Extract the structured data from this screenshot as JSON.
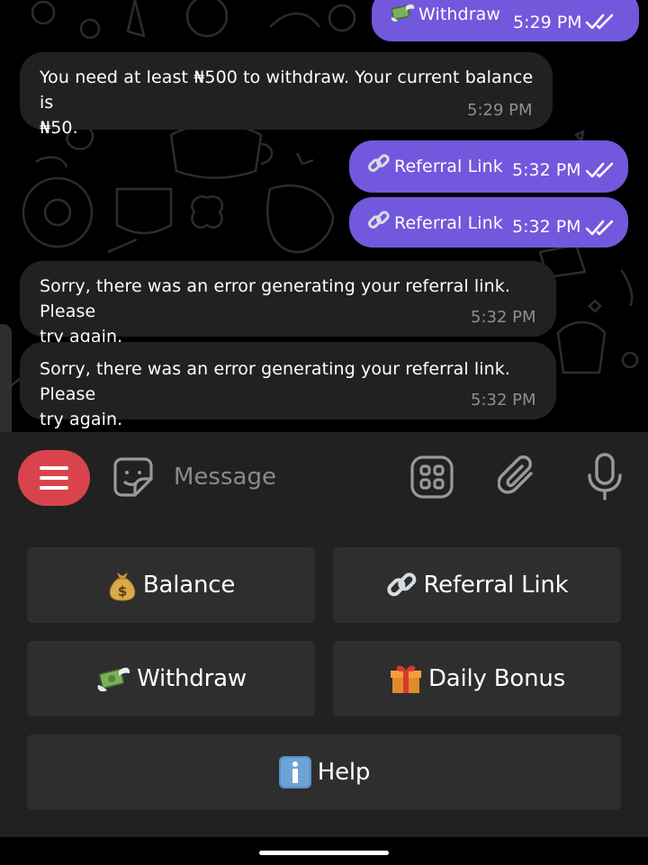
{
  "chat": {
    "messages": [
      {
        "direction": "out",
        "emoji": "money-with-wings",
        "text": "Withdraw",
        "time": "5:29 PM",
        "status": "read"
      },
      {
        "direction": "in",
        "text_line1": "You need at least ₦500 to withdraw. Your current balance is",
        "text_line2": "₦50.",
        "time": "5:29 PM"
      },
      {
        "direction": "out",
        "emoji": "link",
        "text": "Referral Link",
        "time": "5:32 PM",
        "status": "read"
      },
      {
        "direction": "out",
        "emoji": "link",
        "text": "Referral Link",
        "time": "5:32 PM",
        "status": "read"
      },
      {
        "direction": "in",
        "text_line1": "Sorry, there was an error generating your referral link. Please",
        "text_line2": "try again.",
        "time": "5:32 PM"
      },
      {
        "direction": "in",
        "text_line1": "Sorry, there was an error generating your referral link. Please",
        "text_line2": "try again.",
        "time": "5:32 PM"
      }
    ]
  },
  "composer": {
    "placeholder": "Message",
    "icons": [
      "menu-icon",
      "sticker-icon",
      "apps-icon",
      "paperclip-icon",
      "microphone-icon"
    ]
  },
  "keyboard": {
    "buttons": [
      {
        "emoji": "money-bag",
        "label": "Balance"
      },
      {
        "emoji": "link",
        "label": "Referral Link"
      },
      {
        "emoji": "money-with-wings",
        "label": "Withdraw"
      },
      {
        "emoji": "gift",
        "label": "Daily Bonus"
      },
      {
        "emoji": "information",
        "label": "Help"
      }
    ]
  },
  "colors": {
    "outgoing_bubble": "#7258dc",
    "incoming_bubble": "#222122",
    "menu_button": "#d9444c",
    "keyboard_button": "#2e2e2e",
    "panel": "#212121"
  }
}
